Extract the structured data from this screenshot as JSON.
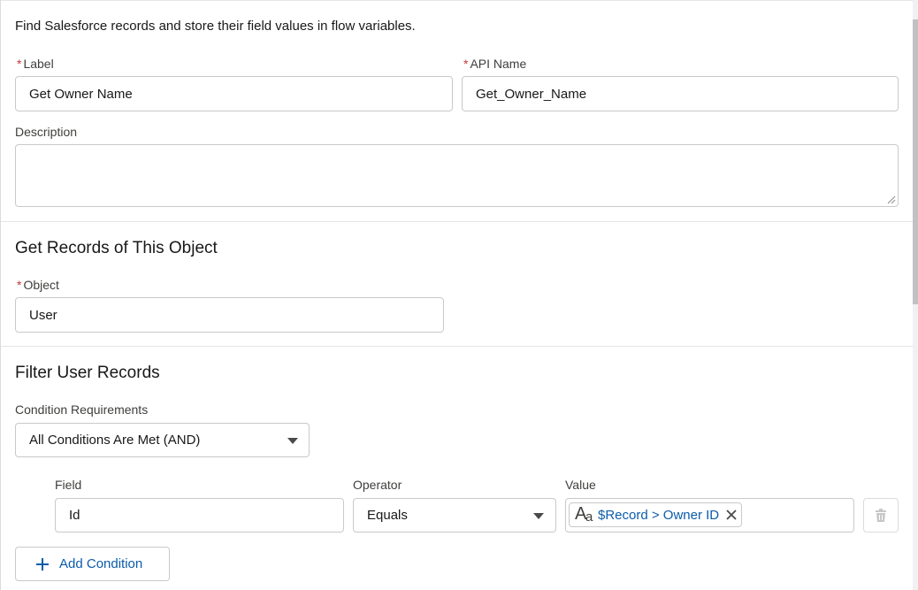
{
  "intro": "Find Salesforce records and store their field values in flow variables.",
  "required_mark": "*",
  "label_field": {
    "label": "Label",
    "value": "Get Owner Name"
  },
  "api_name_field": {
    "label": "API Name",
    "value": "Get_Owner_Name"
  },
  "description_field": {
    "label": "Description",
    "value": ""
  },
  "object_section": {
    "heading": "Get Records of This Object",
    "object_label": "Object",
    "object_value": "User"
  },
  "filter_section": {
    "heading": "Filter User Records",
    "condition_req_label": "Condition Requirements",
    "condition_req_value": "All Conditions Are Met (AND)",
    "columns": {
      "field": "Field",
      "operator": "Operator",
      "value": "Value"
    },
    "condition": {
      "field": "Id",
      "operator": "Equals",
      "value_type_big": "A",
      "value_type_small": "a",
      "value": "$Record > Owner ID"
    },
    "add_condition_label": "Add Condition"
  },
  "icons": {
    "text_type": "text-type-icon",
    "remove": "close-icon",
    "delete": "trash-icon",
    "add": "plus-icon",
    "dropdown": "chevron-down-icon"
  },
  "colors": {
    "brand_link": "#0b5cab",
    "required": "#c23934",
    "border": "#c9c9c9"
  }
}
